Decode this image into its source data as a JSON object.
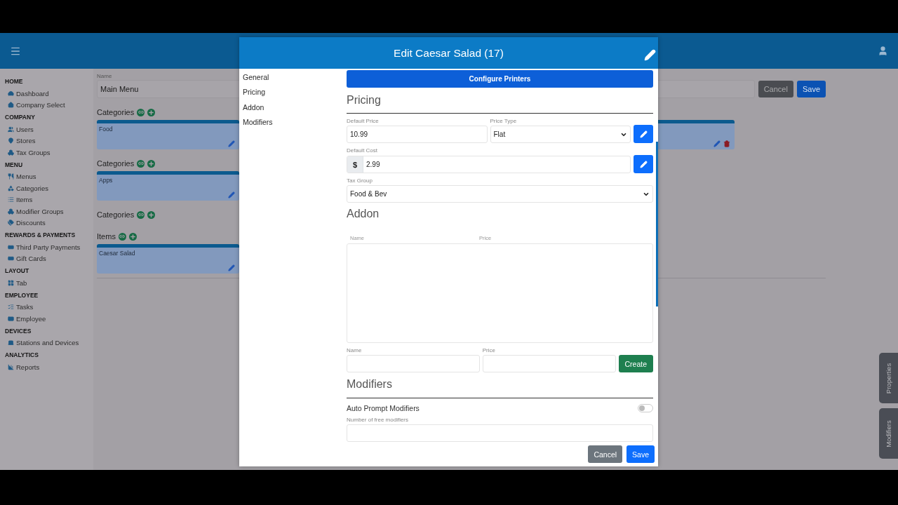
{
  "sidebar": {
    "sections": [
      {
        "title": "HOME",
        "items": [
          {
            "label": "Dashboard"
          },
          {
            "label": "Company Select"
          }
        ]
      },
      {
        "title": "COMPANY",
        "items": [
          {
            "label": "Users"
          },
          {
            "label": "Stores"
          },
          {
            "label": "Tax Groups"
          }
        ]
      },
      {
        "title": "MENU",
        "items": [
          {
            "label": "Menus"
          },
          {
            "label": "Categories"
          },
          {
            "label": "Items"
          },
          {
            "label": "Modifier Groups"
          },
          {
            "label": "Discounts"
          }
        ]
      },
      {
        "title": "REWARDS & PAYMENTS",
        "items": [
          {
            "label": "Third Party Payments"
          },
          {
            "label": "Gift Cards"
          }
        ]
      },
      {
        "title": "LAYOUT",
        "items": [
          {
            "label": "Tab"
          }
        ]
      },
      {
        "title": "EMPLOYEE",
        "items": [
          {
            "label": "Tasks"
          },
          {
            "label": "Employee"
          }
        ]
      },
      {
        "title": "DEVICES",
        "items": [
          {
            "label": "Stations and Devices"
          }
        ]
      },
      {
        "title": "ANALYTICS",
        "items": [
          {
            "label": "Reports"
          }
        ]
      }
    ]
  },
  "main": {
    "name_field": {
      "label": "Name",
      "value": "Main Menu"
    },
    "buttons": [
      "Cancel",
      "Save"
    ],
    "groups": [
      {
        "title": "Categories",
        "cards": [
          {
            "name": "Food"
          },
          {
            "kind": "trailing"
          }
        ]
      },
      {
        "title": "Categories",
        "cards": [
          {
            "name": "Apps"
          }
        ]
      },
      {
        "title": "Categories"
      },
      {
        "title": "Items",
        "cards": [
          {
            "name": "Caesar Salad"
          }
        ]
      }
    ]
  },
  "side_tabs": [
    "Properties",
    "Modifiers"
  ],
  "modal": {
    "title": "Edit Caesar Salad (17)",
    "nav": [
      "General",
      "Pricing",
      "Addon",
      "Modifiers"
    ],
    "configure_button": "Configure Printers",
    "pricing": {
      "heading": "Pricing",
      "default_price": {
        "label": "Default Price",
        "value": "10.99"
      },
      "price_type": {
        "label": "Price Type",
        "value": "Flat"
      },
      "default_cost": {
        "label": "Default Cost",
        "prefix": "$",
        "value": "2.99"
      },
      "tax_group": {
        "label": "Tax Group",
        "value": "Food & Bev"
      }
    },
    "addon": {
      "heading": "Addon",
      "columns": [
        "Name",
        "Price"
      ],
      "new_name_label": "Name",
      "new_price_label": "Price",
      "create_button": "Create"
    },
    "modifiers": {
      "heading": "Modifiers",
      "auto_prompt": {
        "label": "Auto Prompt Modifiers",
        "on": false
      },
      "free_label": "Number of free modifiers"
    },
    "footer_buttons": [
      "Cancel",
      "Save"
    ]
  }
}
